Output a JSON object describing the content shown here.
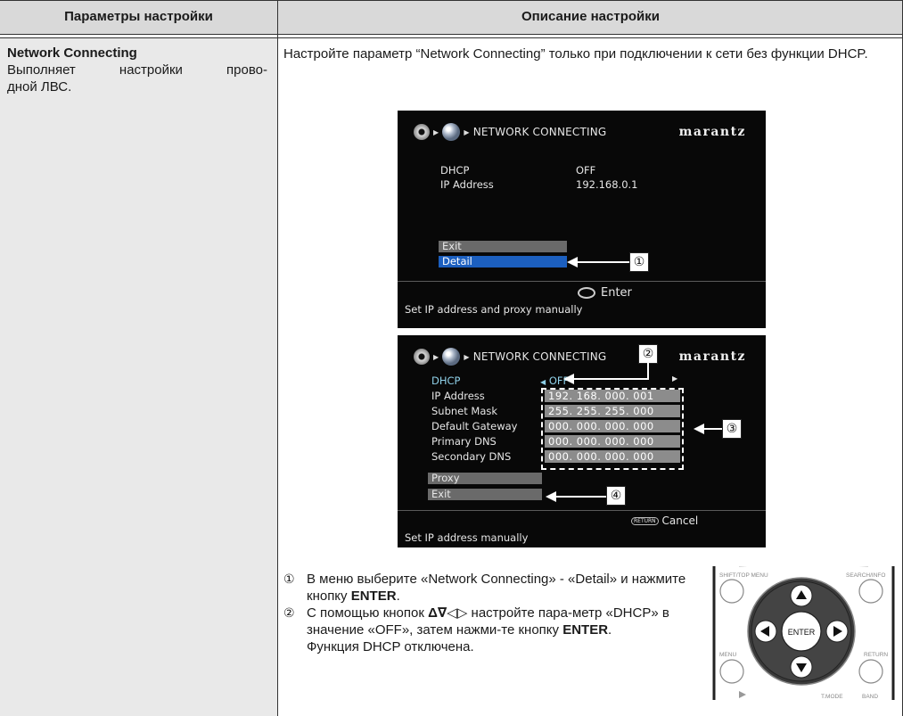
{
  "table": {
    "header_left": "Параметры настройки",
    "header_right": "Описание настройки"
  },
  "left": {
    "title": "Network Connecting",
    "desc_line1": "Выполняет настройки прово-",
    "desc_line2": "дной ЛВС."
  },
  "intro": "Настройте параметр “Network Connecting” только при подключении к сети без функции DHCP.",
  "screen1": {
    "header": "NETWORK CONNECTING",
    "brand": "marantz",
    "rows": [
      {
        "label": "DHCP",
        "value": "OFF"
      },
      {
        "label": "IP Address",
        "value": "192.168.0.1"
      }
    ],
    "exit_label": "Exit",
    "detail_label": "Detail",
    "enter_label": "Enter",
    "footer": "Set IP address and proxy manually"
  },
  "screen2": {
    "header": "NETWORK CONNECTING",
    "brand": "marantz",
    "dhcp_label": "DHCP",
    "dhcp_value": "OFF",
    "fields": [
      {
        "label": "IP Address",
        "value": "192. 168. 000. 001"
      },
      {
        "label": "Subnet Mask",
        "value": "255. 255. 255. 000"
      },
      {
        "label": "Default Gateway",
        "value": "000. 000. 000. 000"
      },
      {
        "label": "Primary DNS",
        "value": "000. 000. 000. 000"
      },
      {
        "label": "Secondary DNS",
        "value": "000. 000. 000. 000"
      }
    ],
    "proxy_label": "Proxy",
    "exit_label": "Exit",
    "return_label": "RETURN",
    "cancel_label": "Cancel",
    "footer": "Set IP address manually"
  },
  "callouts": [
    "①",
    "②",
    "③",
    "④"
  ],
  "steps": [
    {
      "num": "①",
      "text_a": "В меню выберите «Network Connecting» - «Detail» и нажмите кнопку ",
      "bold": "ENTER",
      "text_b": "."
    },
    {
      "num": "②",
      "text_a": "С помощью кнопок ",
      "arrows": "Δ∇◁▷",
      "text_c": " настройте пара-метр «DHCP» в значение «OFF», затем нажми-те кнопку ",
      "bold": "ENTER",
      "text_b": ".",
      "note": "Функция DHCP отключена."
    }
  ],
  "remote": {
    "shift_top_menu": "SHIFT/TOP MENU",
    "search_info": "SEARCH/INFO",
    "enter": "ENTER",
    "menu": "MENU",
    "return": "RETURN",
    "tmode": "T.MODE",
    "band": "BAND"
  }
}
